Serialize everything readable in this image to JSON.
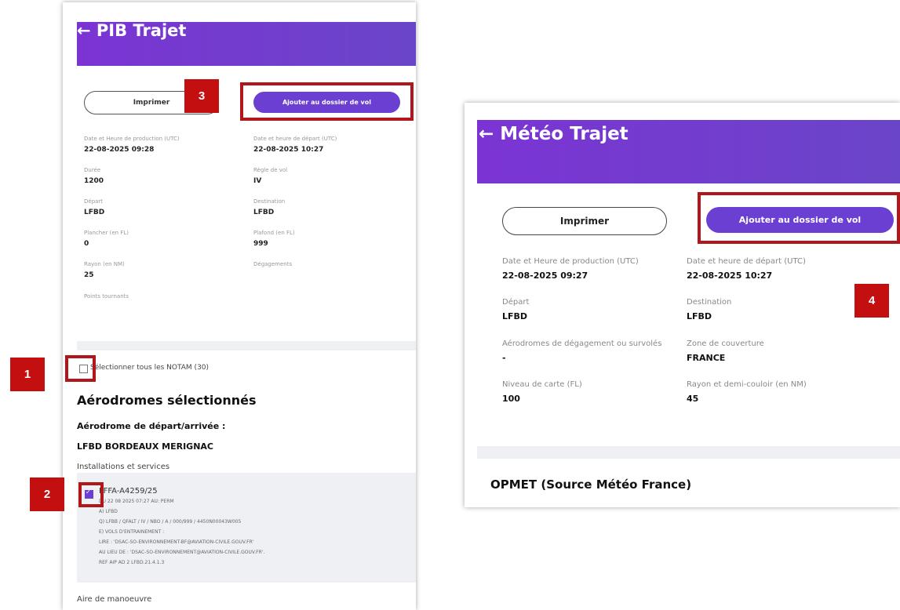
{
  "pib": {
    "title": "← PIB Trajet",
    "print_label": "Imprimer",
    "add_label": "Ajouter au dossier de vol",
    "fields": [
      {
        "label": "Date et Heure de production (UTC)",
        "value": "22-08-2025 09:28"
      },
      {
        "label": "Date et heure de départ (UTC)",
        "value": "22-08-2025 10:27"
      },
      {
        "label": "Durée",
        "value": "1200"
      },
      {
        "label": "Règle de vol",
        "value": "IV"
      },
      {
        "label": "Départ",
        "value": "LFBD"
      },
      {
        "label": "Destination",
        "value": "LFBD"
      },
      {
        "label": "Plancher (en FL)",
        "value": "0"
      },
      {
        "label": "Plafond (en FL)",
        "value": "999"
      },
      {
        "label": "Rayon (en NM)",
        "value": "25"
      },
      {
        "label": "Dégagements",
        "value": ""
      },
      {
        "label": "Points tournants",
        "value": ""
      }
    ],
    "select_all_label": "Sélectionner tous les NOTAM (30)",
    "selected_aerodromes_heading": "Aérodromes sélectionnés",
    "dep_arr_heading": "Aérodrome de départ/arrivée :",
    "aerodrome_name": "LFBD BORDEAUX MERIGNAC",
    "category": "Installations et services",
    "notam_id": "LFFA-A4259/25",
    "notam_lines": [
      "DU 22 08 2025 07:27 AU: PERM",
      "A) LFBD",
      "Q) LFBB / QFALT / IV / NBO / A / 000/999 / 4450N00043W005",
      "E) VOLS D'ENTRAINEMENT :",
      "LIRE : 'DSAC-SO-ENVIRONNEMENT-BF@AVIATION-CIVILE.GOUV.FR'",
      "AU LIEU DE : 'DSAC-SO-ENVIRONNEMENT@AVIATION-CIVILE.GOUV.FR'.",
      "REF AIP AD 2 LFBD.21.4.1.3"
    ],
    "next_category": "Aire de manoeuvre"
  },
  "meteo": {
    "title": "← Météo Trajet",
    "print_label": "Imprimer",
    "add_label": "Ajouter au dossier de vol",
    "fields": [
      {
        "label": "Date et Heure de production (UTC)",
        "value": "22-08-2025 09:27"
      },
      {
        "label": "Date et heure de départ (UTC)",
        "value": "22-08-2025 10:27"
      },
      {
        "label": "Départ",
        "value": "LFBD"
      },
      {
        "label": "Destination",
        "value": "LFBD"
      },
      {
        "label": "Aérodromes de dégagement ou survolés",
        "value": "-"
      },
      {
        "label": "Zone de couverture",
        "value": "FRANCE"
      },
      {
        "label": "Niveau de carte (FL)",
        "value": "100"
      },
      {
        "label": "Rayon et demi-couloir (en NM)",
        "value": "45"
      }
    ],
    "opmet_heading": "OPMET (Source Météo France)"
  },
  "annotations": [
    "1",
    "2",
    "3",
    "4"
  ],
  "colors": {
    "accent": "#6a3fd1",
    "annotation": "#c40f10"
  }
}
